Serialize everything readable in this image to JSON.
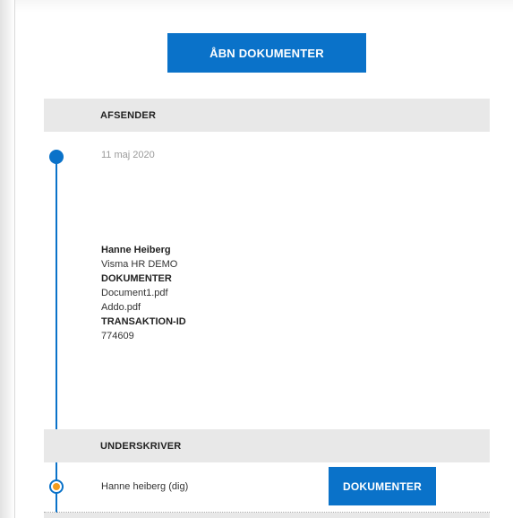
{
  "actions": {
    "open_documents_label": "ÅBN DOKUMENTER"
  },
  "sender_section": {
    "header": "AFSENDER",
    "date": "11 maj 2020",
    "name": "Hanne Heiberg",
    "organization": "Visma HR DEMO",
    "documents_label": "DOKUMENTER",
    "documents": [
      "Document1.pdf",
      "Addo.pdf"
    ],
    "transaction_label": "TRANSAKTION-ID",
    "transaction_id": "774609"
  },
  "signer_section": {
    "header": "UNDERSKRIVER",
    "signer_name": "Hanne heiberg (dig)",
    "documents_button_label": "DOKUMENTER"
  },
  "colors": {
    "accent": "#0a72c9",
    "pending": "#f29b1d",
    "header_bg": "#e8e8e8"
  }
}
